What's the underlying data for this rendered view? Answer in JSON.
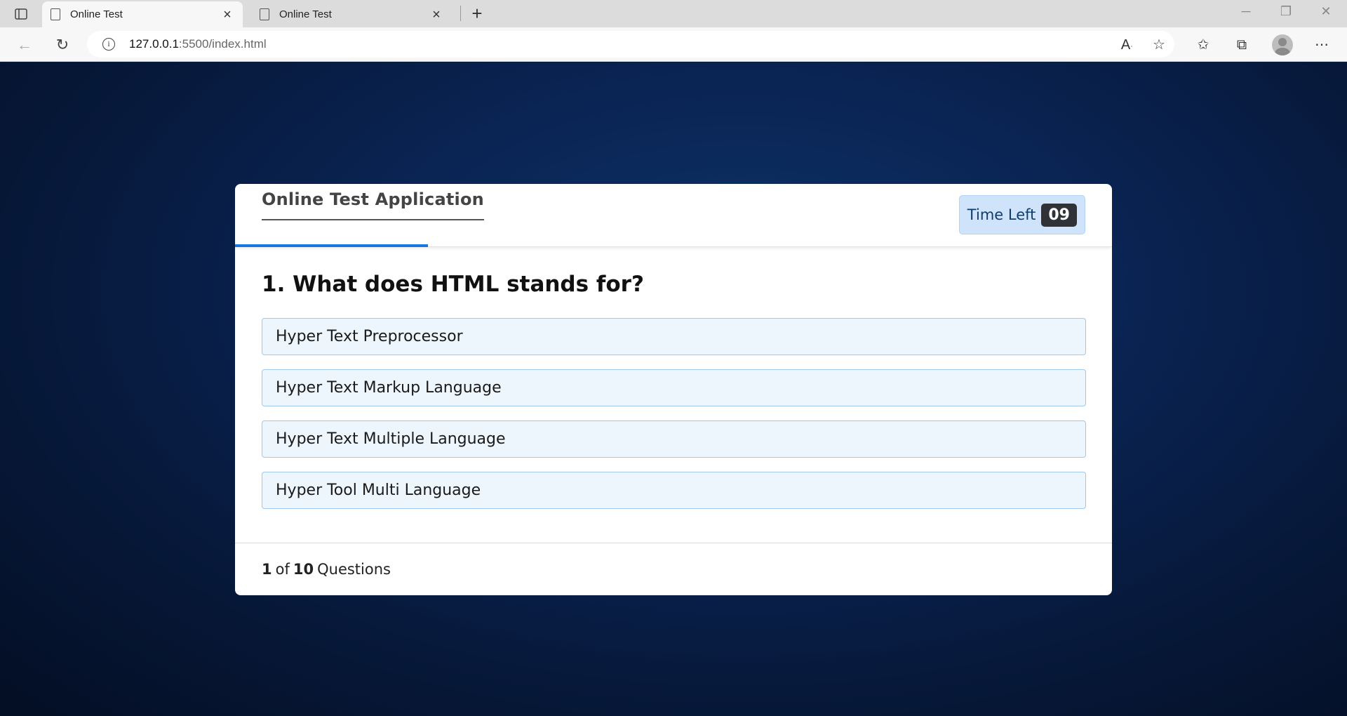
{
  "browser": {
    "tabs": [
      {
        "title": "Online Test",
        "active": true
      },
      {
        "title": "Online Test",
        "active": false
      }
    ],
    "url_host": "127.0.0.1",
    "url_path": ":5500/index.html",
    "icons": [
      "tab-actions-icon",
      "back-icon",
      "refresh-icon",
      "info-icon",
      "read-aloud-icon",
      "add-favorite-icon",
      "favorites-icon",
      "collections-icon",
      "profile-icon",
      "more-icon"
    ]
  },
  "app": {
    "title": "Online Test Application",
    "timer_label": "Time Left",
    "timer_value": "09",
    "progress_fraction": 0.22
  },
  "question": {
    "text": "1. What does HTML stands for?",
    "options": [
      "Hyper Text Preprocessor",
      "Hyper Text Markup Language",
      "Hyper Text Multiple Language",
      "Hyper Tool Multi Language"
    ]
  },
  "footer": {
    "current": "1",
    "of_word": "of",
    "total": "10",
    "suffix": "Questions"
  },
  "colors": {
    "accent": "#1976e0",
    "timer_bg": "#cfe4fb",
    "option_bg": "#eef6fd",
    "option_border": "#9ec8ee"
  }
}
